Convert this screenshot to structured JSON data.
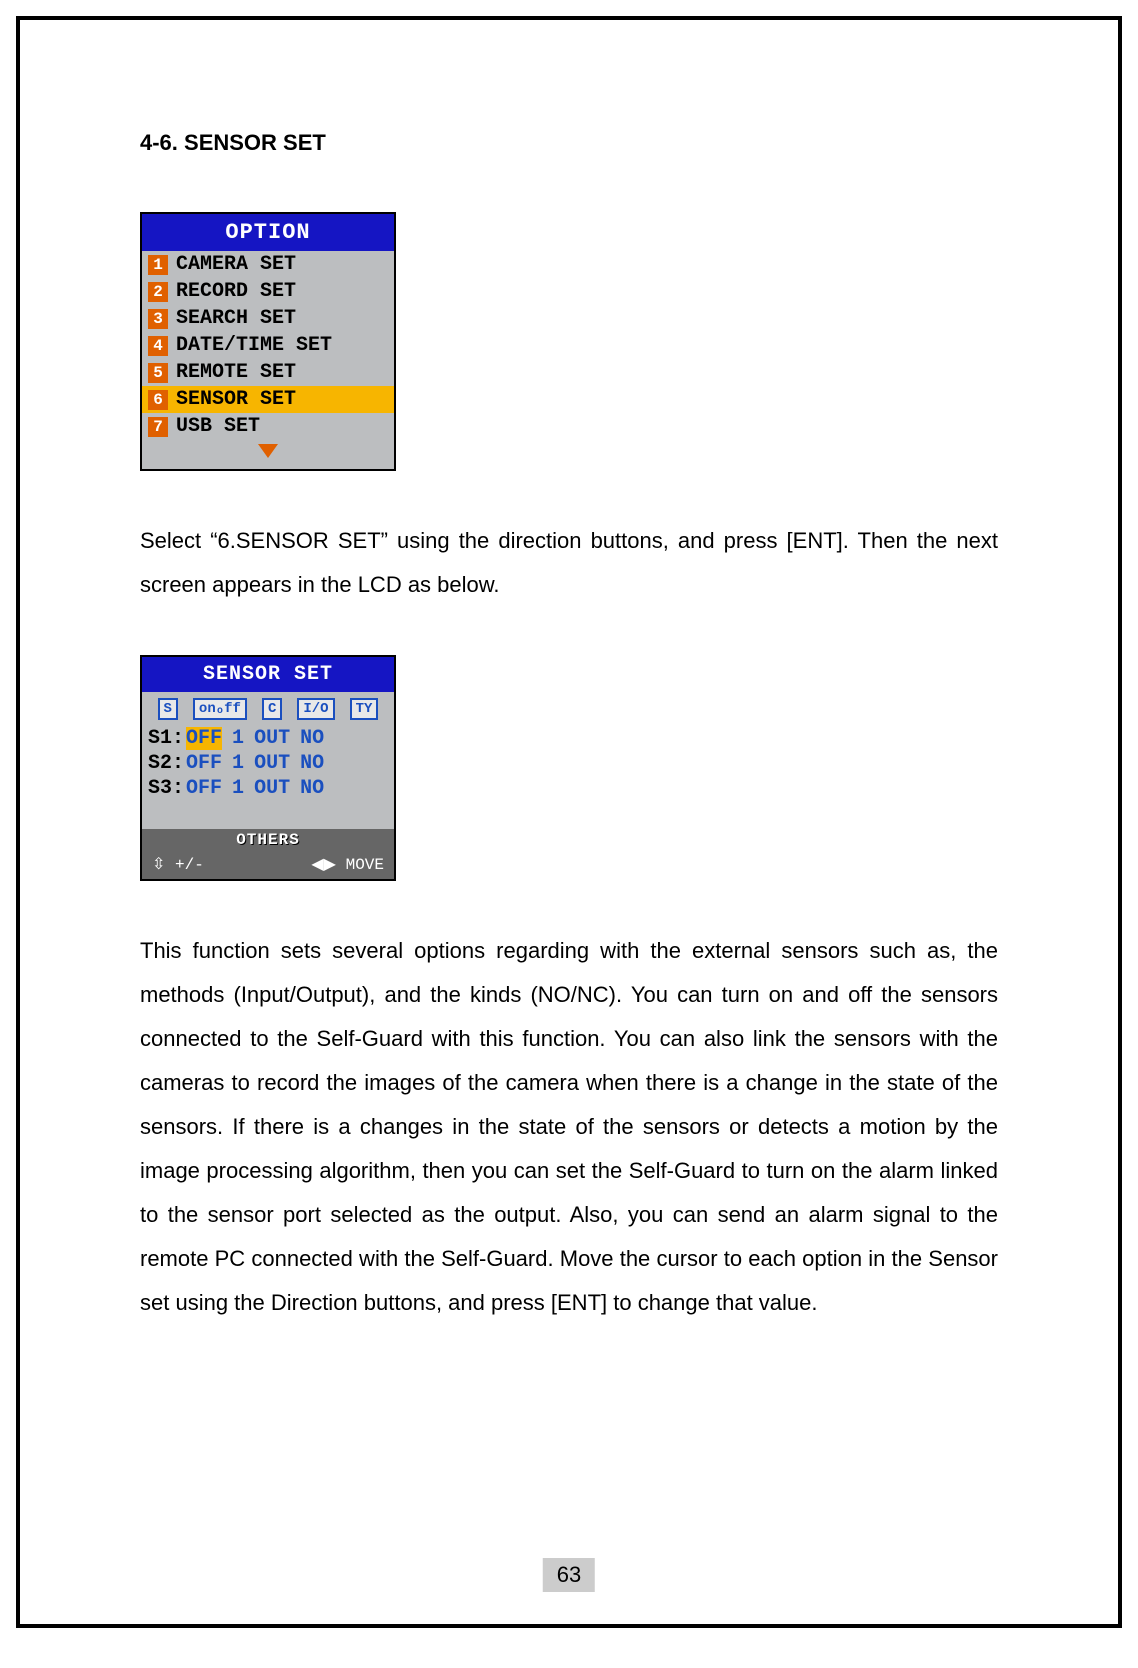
{
  "section_title": "4-6. SENSOR SET",
  "option_menu": {
    "title": "OPTION",
    "items": [
      {
        "num": "1",
        "label": "CAMERA SET",
        "highlight": false
      },
      {
        "num": "2",
        "label": "RECORD SET",
        "highlight": false
      },
      {
        "num": "3",
        "label": "SEARCH SET",
        "highlight": false
      },
      {
        "num": "4",
        "label": "DATE/TIME SET",
        "highlight": false
      },
      {
        "num": "5",
        "label": "REMOTE SET",
        "highlight": false
      },
      {
        "num": "6",
        "label": "SENSOR SET",
        "highlight": true
      },
      {
        "num": "7",
        "label": "USB SET",
        "highlight": false
      }
    ]
  },
  "para1": "Select “6.SENSOR SET” using the direction buttons, and press [ENT]. Then the next screen appears in the LCD as below.",
  "sensor_menu": {
    "title": "SENSOR SET",
    "headers": [
      "S",
      "onₒff",
      "C",
      "I/O",
      "TY"
    ],
    "rows": [
      {
        "name": "S1",
        "off": "OFF",
        "c": "1",
        "io": "OUT",
        "ty": "NO",
        "highlight": true
      },
      {
        "name": "S2",
        "off": "OFF",
        "c": "1",
        "io": "OUT",
        "ty": "NO",
        "highlight": false
      },
      {
        "name": "S3",
        "off": "OFF",
        "c": "1",
        "io": "OUT",
        "ty": "NO",
        "highlight": false
      }
    ],
    "others": "OTHERS",
    "footer_left": "+/-",
    "footer_right": "MOVE"
  },
  "para2": "This function sets several options regarding with the external sensors such as, the methods (Input/Output), and the kinds (NO/NC). You can turn on and off the sensors connected to the Self-Guard with this function. You can also link the sensors with the cameras to record the images of the camera when there is a change in the state of the sensors. If there is a changes in the state of the sensors or detects a motion by the image processing algorithm, then you can set the Self-Guard to turn on the alarm linked to the sensor port selected as the output. Also, you can send an alarm signal to the remote PC connected with the Self-Guard. Move the cursor to each option in the Sensor set using the Direction buttons, and press [ENT] to change that value.",
  "page_number": "63"
}
